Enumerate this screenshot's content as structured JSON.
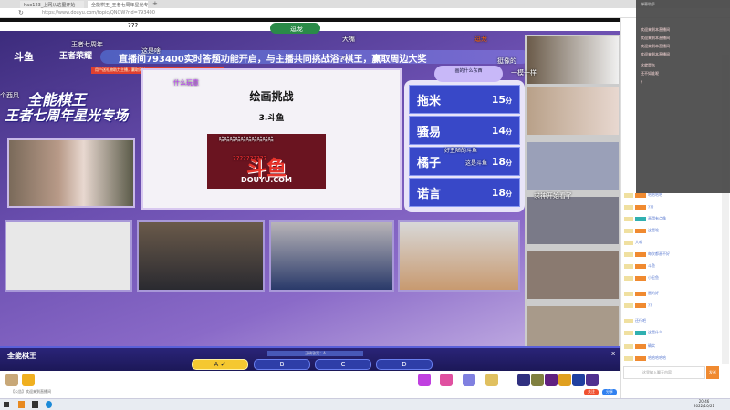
{
  "browser": {
    "tabs": [
      {
        "label": "hao123_上网从这里开始"
      },
      {
        "label": "全能棋王_王者七周年星光专场"
      }
    ],
    "url": "https://www.douyu.com/topic/QNQW?rid=793400"
  },
  "stream": {
    "logo": "斗鱼",
    "logo2": "王者荣耀",
    "anniv": "王者七周年",
    "title_line1": "全能棋王",
    "title_line2": "王者七周年星光专场",
    "banner": "直播间793400实时答题功能开启，与主播共同挑战浴?棋王，赢取周边大奖",
    "redbar": "用户送礼物助力主播，赢取周边",
    "danmaku": [
      "???",
      "这是啥",
      "什么玩意",
      "?",
      "大嘴",
      "逗龙",
      "一模一样",
      "挺像的",
      "哈哈哈哈哈哈哈哈哈哈",
      "好丑陋的斗鱼",
      "这是斗鱼",
      "个西风",
      "求神开始看了",
      "??????????"
    ],
    "anchor_badge": "逗龙",
    "board": {
      "title": "绘画挑战",
      "subtitle": "3.斗鱼",
      "image_text": "斗鱼",
      "image_sub": "DOUYU.COM"
    },
    "scoreboard": {
      "header": "画的什么东西",
      "rows": [
        {
          "name": "拖米",
          "score": "15",
          "unit": "分"
        },
        {
          "name": "骚易",
          "score": "14",
          "unit": "分"
        },
        {
          "name": "橘子",
          "score": "18",
          "unit": "分"
        },
        {
          "name": "诺言",
          "score": "18",
          "unit": "分"
        }
      ]
    }
  },
  "quiz": {
    "title": "全能棋王",
    "hint": "正确答案：A",
    "options": [
      "A",
      "B",
      "C",
      "D"
    ],
    "selected": "A",
    "close": "x"
  },
  "giftbar": {
    "notice": "【公告】欢迎来到直播间",
    "follow": "关注",
    "share": "分享"
  },
  "chat": {
    "overlay_title": "弹幕助手",
    "overlay_rows": [
      "欢迎来到本直播间",
      "欢迎来到本直播间",
      "欢迎来到本直播间",
      "欢迎来到本直播间",
      "这就是鸟",
      "还不如谁呢",
      "?"
    ],
    "messages": [
      "哈哈哈哈",
      "???",
      "画得有点像",
      "这是啥",
      "大嘴",
      "每次都画不好",
      "斗鱼",
      "小丑鱼",
      "画的好",
      "??",
      "还行吧",
      "这是什么",
      "确实",
      "哈哈哈哈哈"
    ],
    "input_placeholder": "这里输入聊天内容",
    "send": "发送"
  },
  "taskbar": {
    "time": "20:46",
    "date": "2022/10/21"
  }
}
